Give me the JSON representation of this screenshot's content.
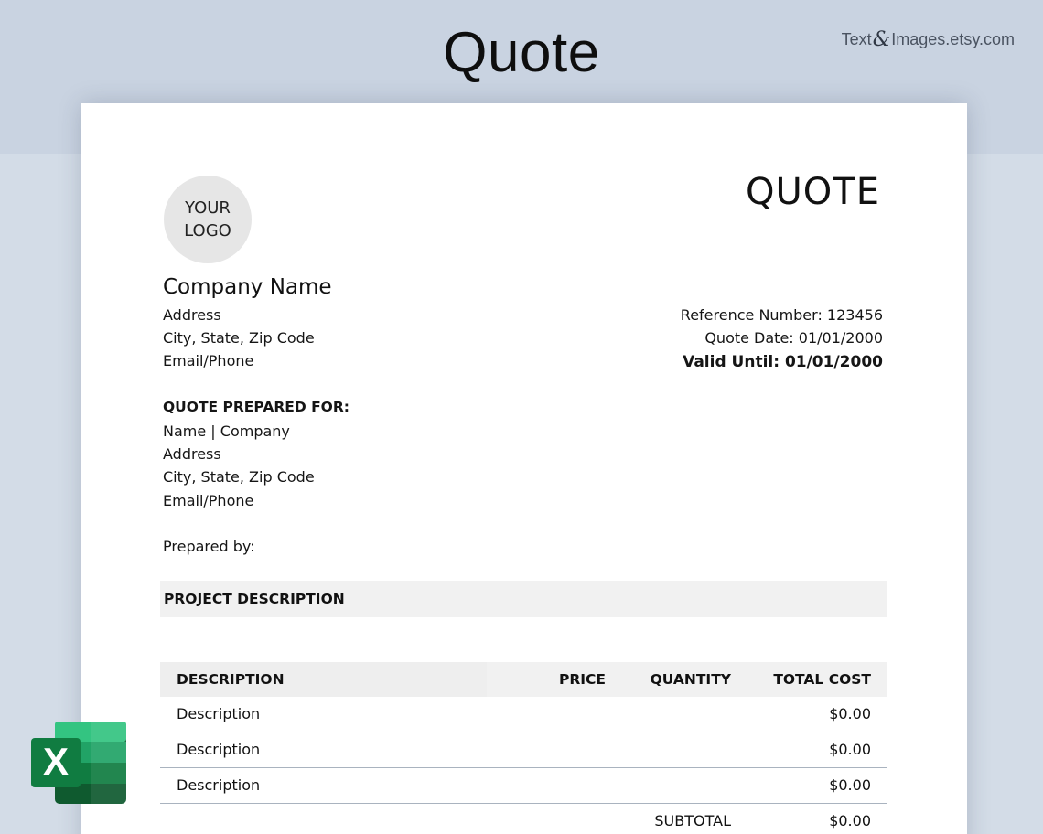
{
  "banner": {
    "title": "Quote",
    "brand_left": "Text",
    "brand_amp": "&",
    "brand_right": "Images.etsy.com"
  },
  "document": {
    "logo_line1": "YOUR",
    "logo_line2": "LOGO",
    "title": "QUOTE",
    "company": {
      "name": "Company Name",
      "address": "Address",
      "city": "City, State, Zip Code",
      "contact": "Email/Phone"
    },
    "meta": {
      "reference": "Reference Number: 123456",
      "quote_date": "Quote Date: 01/01/2000",
      "valid_until": "Valid Until: 01/01/2000"
    },
    "prepared_for": {
      "heading": "QUOTE PREPARED FOR:",
      "name": "Name | Company",
      "address": "Address",
      "city": "City, State, Zip Code",
      "contact": "Email/Phone"
    },
    "prepared_by": "Prepared by:",
    "project_description": "PROJECT DESCRIPTION",
    "table": {
      "headers": {
        "description": "DESCRIPTION",
        "price": "PRICE",
        "quantity": "QUANTITY",
        "total": "TOTAL COST"
      },
      "rows": [
        {
          "description": "Description",
          "price": "",
          "quantity": "",
          "total": "$0.00"
        },
        {
          "description": "Description",
          "price": "",
          "quantity": "",
          "total": "$0.00"
        },
        {
          "description": "Description",
          "price": "",
          "quantity": "",
          "total": "$0.00"
        }
      ],
      "subtotal_label": "SUBTOTAL",
      "subtotal_value": "$0.00"
    }
  },
  "excel_icon": {
    "glyph": "X",
    "colors": [
      "#33c481",
      "#21a366",
      "#107c41",
      "#185c37",
      "#0f5a2f"
    ]
  }
}
